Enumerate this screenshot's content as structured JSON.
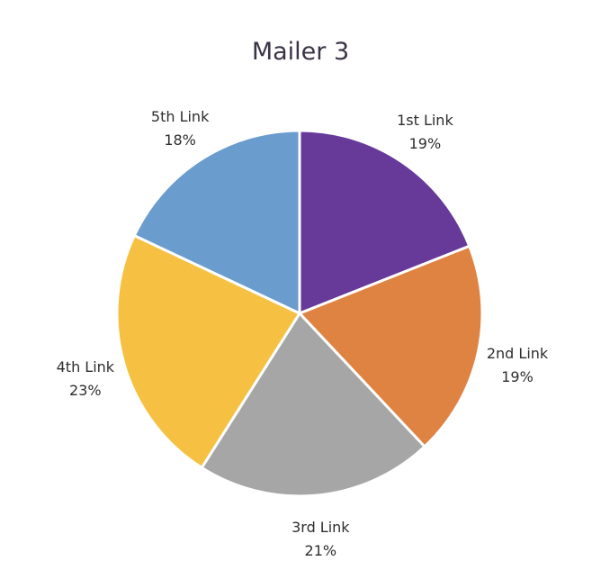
{
  "chart_data": {
    "type": "pie",
    "title": "Mailer 3",
    "colors": {
      "slice_border": "#ffffff",
      "title_text": "#3b3346",
      "label_text": "#2e2e2e"
    },
    "slices": [
      {
        "label": "1st Link",
        "value": 19,
        "value_label": "19%",
        "color": "#673a9a"
      },
      {
        "label": "2nd Link",
        "value": 19,
        "value_label": "19%",
        "color": "#df8342"
      },
      {
        "label": "3rd Link",
        "value": 21,
        "value_label": "21%",
        "color": "#a6a6a6"
      },
      {
        "label": "4th Link",
        "value": 23,
        "value_label": "23%",
        "color": "#f6c143"
      },
      {
        "label": "5th Link",
        "value": 18,
        "value_label": "18%",
        "color": "#6a9cce"
      }
    ]
  }
}
